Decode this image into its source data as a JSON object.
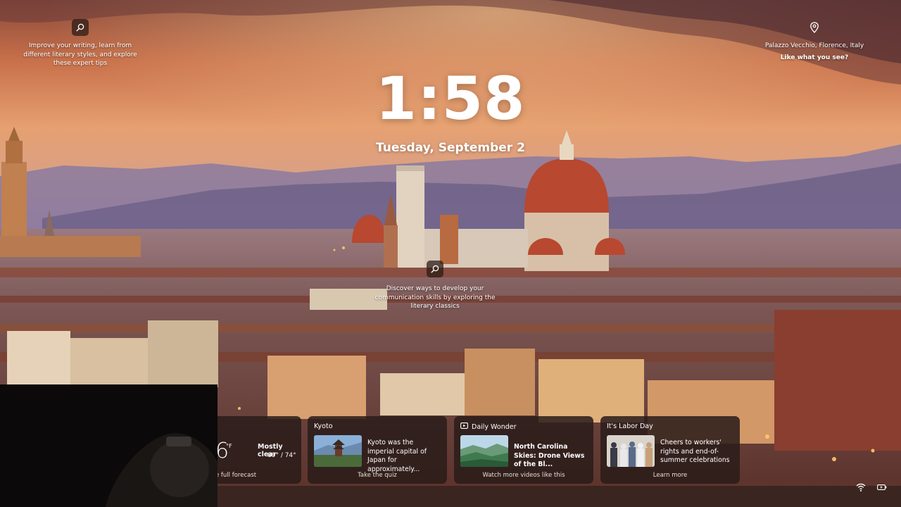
{
  "hotspots": {
    "top_left": {
      "text": "Improve your writing, learn from different literary styles, and explore these expert tips",
      "icon": "search-icon"
    },
    "middle": {
      "text": "Discover ways to develop your communication skills by exploring the literary classics",
      "icon": "search-icon"
    },
    "top_right": {
      "location": "Palazzo Vecchio, Florence, Italy",
      "cta": "Like what you see?",
      "icon": "location-pin-icon"
    }
  },
  "clock": {
    "time": "1:58",
    "date": "Tuesday, September 2"
  },
  "widgets": {
    "weather": {
      "temp": "6",
      "unit": "°F",
      "condition": "Mostly clear",
      "hilo": "89° / 74°",
      "footer": "e full forecast"
    },
    "kyoto": {
      "title": "Kyoto",
      "text": "Kyoto was the imperial capital of Japan for approximately...",
      "footer": "Take the quiz"
    },
    "daily_wonder": {
      "title": "Daily Wonder",
      "text": "North Carolina Skies: Drone Views of the Bl...",
      "footer": "Watch more videos like this",
      "icon": "video-icon"
    },
    "labor_day": {
      "title": "It's Labor Day",
      "text": "Cheers to workers' rights and end-of-summer celebrations",
      "footer": "Learn more"
    }
  },
  "tray": {
    "wifi_icon": "wifi-icon",
    "battery_icon": "battery-icon"
  }
}
